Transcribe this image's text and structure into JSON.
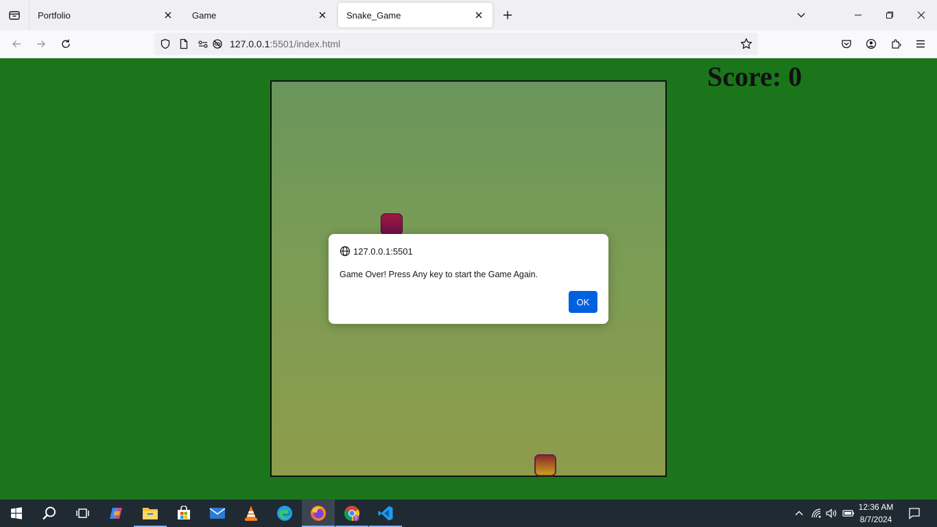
{
  "browser": {
    "tabs": [
      {
        "title": "Portfolio",
        "active": false
      },
      {
        "title": "Game",
        "active": false
      },
      {
        "title": "Snake_Game",
        "active": true
      }
    ],
    "url_host": "127.0.0.1",
    "url_rest": ":5501/index.html"
  },
  "game": {
    "score_text": "Score: 0"
  },
  "dialog": {
    "origin": "127.0.0.1:5501",
    "message": "Game Over! Press Any key to start the Game Again.",
    "ok_label": "OK"
  },
  "taskbar": {
    "apps": [
      "start-icon",
      "search-icon",
      "task-view-icon",
      "copilot-icon",
      "file-explorer-icon",
      "microsoft-store-icon",
      "mail-icon",
      "vlc-icon",
      "edge-icon",
      "firefox-icon",
      "chrome-icon",
      "vscode-icon"
    ],
    "active_app": "firefox-icon",
    "time": "12:36 AM",
    "date": "8/7/2024"
  },
  "colors": {
    "page_background": "#1b761b",
    "dialog_button": "#0061e0",
    "taskbar": "#202a33"
  }
}
